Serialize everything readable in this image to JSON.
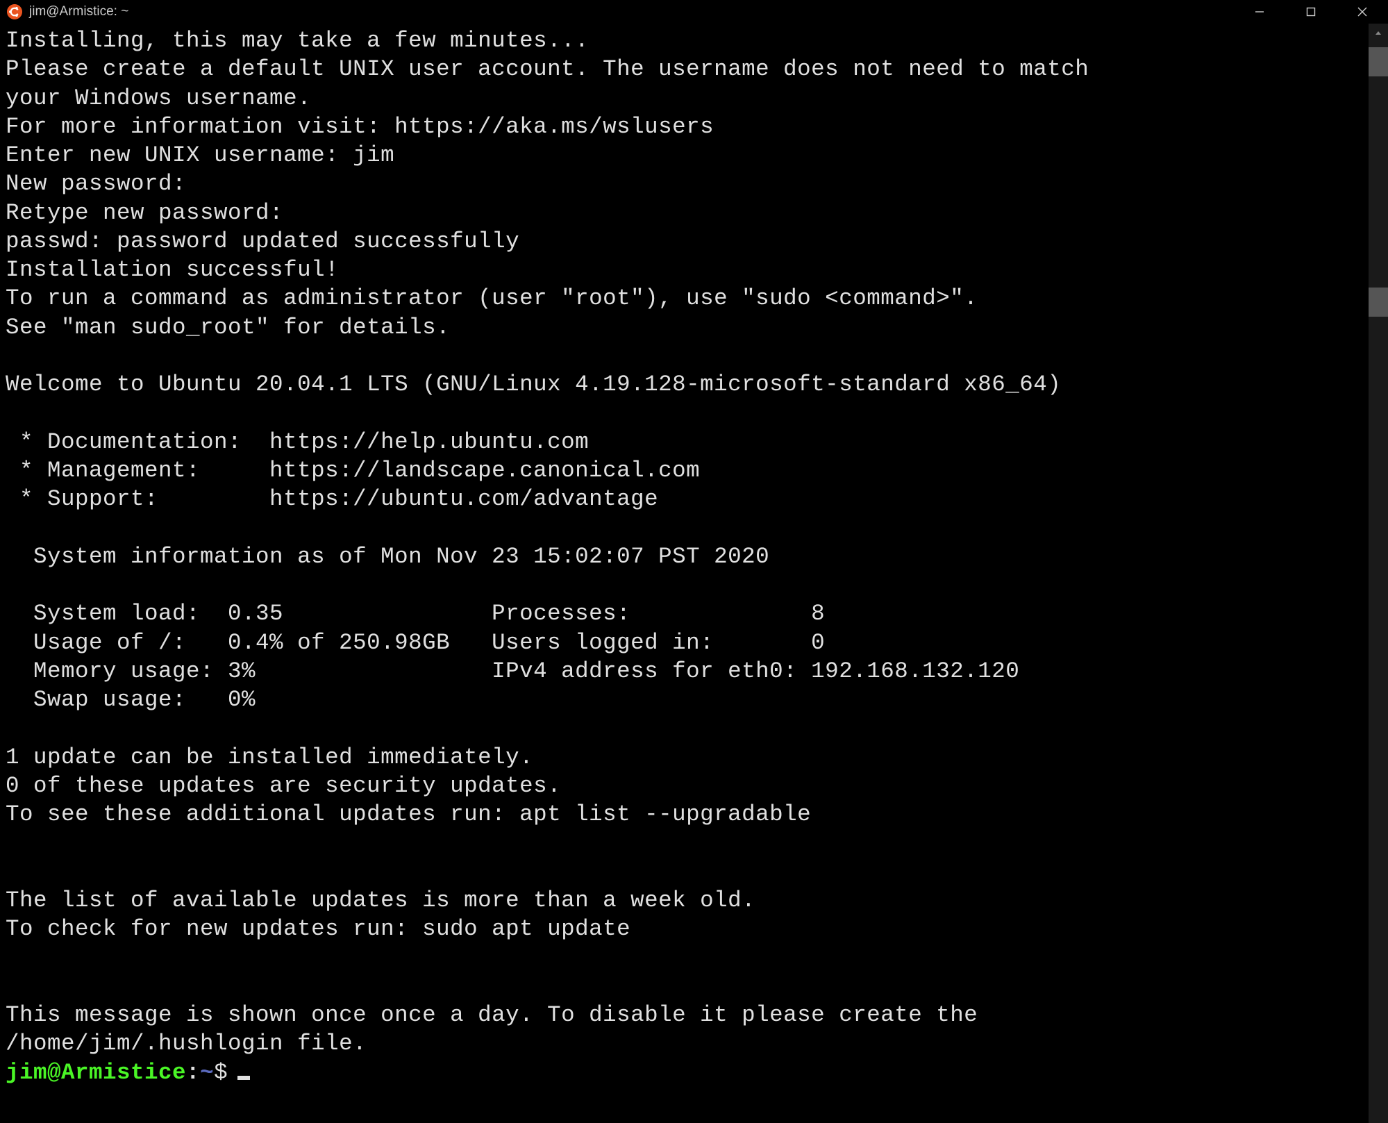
{
  "title": "jim@Armistice: ~",
  "lines": [
    "Installing, this may take a few minutes...",
    "Please create a default UNIX user account. The username does not need to match",
    "your Windows username.",
    "For more information visit: https://aka.ms/wslusers",
    "Enter new UNIX username: jim",
    "New password:",
    "Retype new password:",
    "passwd: password updated successfully",
    "Installation successful!",
    "To run a command as administrator (user \"root\"), use \"sudo <command>\".",
    "See \"man sudo_root\" for details.",
    "",
    "Welcome to Ubuntu 20.04.1 LTS (GNU/Linux 4.19.128-microsoft-standard x86_64)",
    "",
    " * Documentation:  https://help.ubuntu.com",
    " * Management:     https://landscape.canonical.com",
    " * Support:        https://ubuntu.com/advantage",
    "",
    "  System information as of Mon Nov 23 15:02:07 PST 2020",
    "",
    "  System load:  0.35               Processes:             8",
    "  Usage of /:   0.4% of 250.98GB   Users logged in:       0",
    "  Memory usage: 3%                 IPv4 address for eth0: 192.168.132.120",
    "  Swap usage:   0%",
    "",
    "1 update can be installed immediately.",
    "0 of these updates are security updates.",
    "To see these additional updates run: apt list --upgradable",
    "",
    "",
    "The list of available updates is more than a week old.",
    "To check for new updates run: sudo apt update",
    "",
    "",
    "This message is shown once once a day. To disable it please create the",
    "/home/jim/.hushlogin file."
  ],
  "prompt": {
    "user_host": "jim@Armistice",
    "colon": ":",
    "path": "~",
    "dollar": "$"
  }
}
